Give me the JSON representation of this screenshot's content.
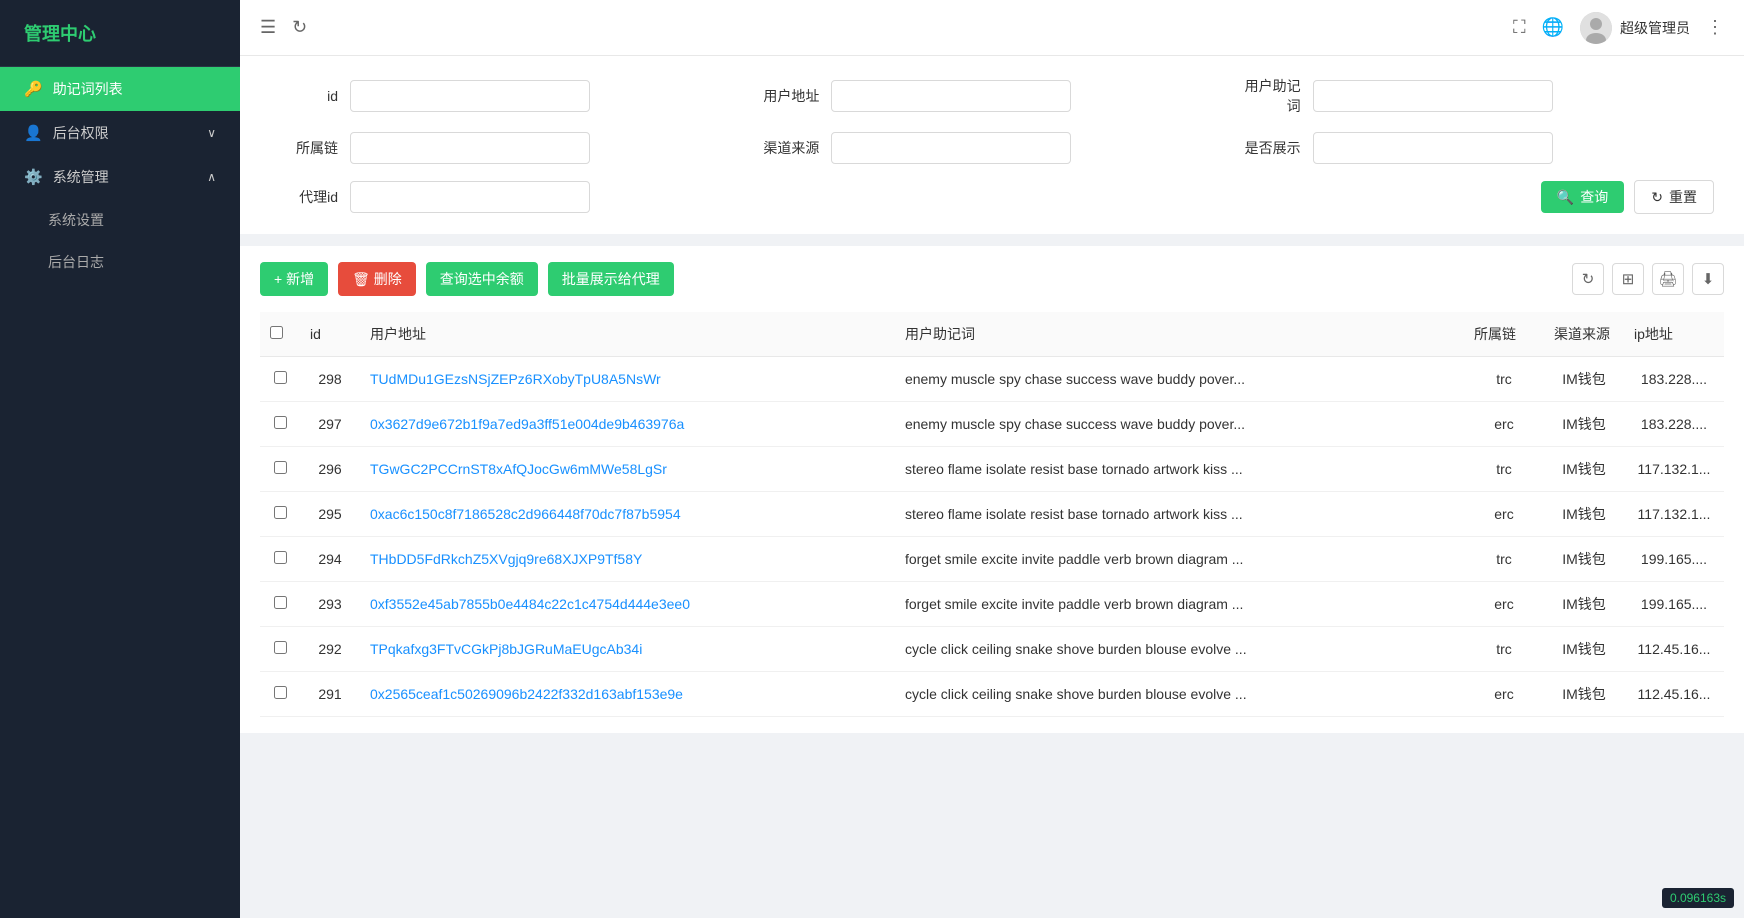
{
  "sidebar": {
    "title": "管理中心",
    "items": [
      {
        "id": "mnemonic",
        "label": "助记词列表",
        "icon": "🔑",
        "active": true,
        "hasChildren": false
      },
      {
        "id": "backend-perms",
        "label": "后台权限",
        "icon": "👤",
        "active": false,
        "hasChildren": true,
        "expanded": false
      },
      {
        "id": "system-mgmt",
        "label": "系统管理",
        "icon": "⚙️",
        "active": false,
        "hasChildren": true,
        "expanded": true
      }
    ],
    "subItems": [
      {
        "id": "system-settings",
        "label": "系统设置",
        "parent": "system-mgmt"
      },
      {
        "id": "backend-log",
        "label": "后台日志",
        "parent": "system-mgmt"
      }
    ]
  },
  "header": {
    "toggleIcon": "☰",
    "refreshIcon": "↻",
    "fullscreenIcon": "⛶",
    "globeIcon": "🌐",
    "moreIcon": "⋮",
    "username": "超级管理员"
  },
  "filter": {
    "fields": [
      {
        "id": "id",
        "label": "id",
        "placeholder": ""
      },
      {
        "id": "user-address",
        "label": "用户地址",
        "placeholder": ""
      },
      {
        "id": "user-mnemonic",
        "label": "用户助记词",
        "placeholder": ""
      },
      {
        "id": "chain",
        "label": "所属链",
        "placeholder": ""
      },
      {
        "id": "channel-source",
        "label": "渠道来源",
        "placeholder": ""
      },
      {
        "id": "is-show",
        "label": "是否展示",
        "placeholder": ""
      },
      {
        "id": "agent-id",
        "label": "代理id",
        "placeholder": ""
      }
    ],
    "searchBtn": "查询",
    "resetBtn": "重置"
  },
  "toolbar": {
    "addBtn": "+ 新增",
    "deleteBtn": "🗑 删除",
    "queryBalanceBtn": "查询选中余额",
    "batchShowBtn": "批量展示给代理"
  },
  "table": {
    "columns": [
      {
        "id": "checkbox",
        "label": ""
      },
      {
        "id": "id",
        "label": "id"
      },
      {
        "id": "user-address",
        "label": "用户地址"
      },
      {
        "id": "user-mnemonic",
        "label": "用户助记词"
      },
      {
        "id": "chain",
        "label": "所属链"
      },
      {
        "id": "channel-source",
        "label": "渠道来源"
      },
      {
        "id": "ip-address",
        "label": "ip地址"
      }
    ],
    "rows": [
      {
        "id": "298",
        "userAddress": "TUdMDu1GEzsNSjZEPz6RXobyTpU8A5NsWr",
        "userMnemonic": "enemy muscle spy chase success wave buddy pover...",
        "chain": "trc",
        "channelSource": "IM钱包",
        "ipAddress": "183.228...."
      },
      {
        "id": "297",
        "userAddress": "0x3627d9e672b1f9a7ed9a3ff51e004de9b463976a",
        "userMnemonic": "enemy muscle spy chase success wave buddy pover...",
        "chain": "erc",
        "channelSource": "IM钱包",
        "ipAddress": "183.228...."
      },
      {
        "id": "296",
        "userAddress": "TGwGC2PCCrnST8xAfQJocGw6mMWe58LgSr",
        "userMnemonic": "stereo flame isolate resist base tornado artwork kiss ...",
        "chain": "trc",
        "channelSource": "IM钱包",
        "ipAddress": "117.132.1..."
      },
      {
        "id": "295",
        "userAddress": "0xac6c150c8f7186528c2d966448f70dc7f87b5954",
        "userMnemonic": "stereo flame isolate resist base tornado artwork kiss ...",
        "chain": "erc",
        "channelSource": "IM钱包",
        "ipAddress": "117.132.1..."
      },
      {
        "id": "294",
        "userAddress": "THbDD5FdRkchZ5XVgjq9re68XJXP9Tf58Y",
        "userMnemonic": "forget smile excite invite paddle verb brown diagram ...",
        "chain": "trc",
        "channelSource": "IM钱包",
        "ipAddress": "199.165...."
      },
      {
        "id": "293",
        "userAddress": "0xf3552e45ab7855b0e4484c22c1c4754d444e3ee0",
        "userMnemonic": "forget smile excite invite paddle verb brown diagram ...",
        "chain": "erc",
        "channelSource": "IM钱包",
        "ipAddress": "199.165...."
      },
      {
        "id": "292",
        "userAddress": "TPqkafxg3FTvCGkPj8bJGRuMaEUgcAb34i",
        "userMnemonic": "cycle click ceiling snake shove burden blouse evolve ...",
        "chain": "trc",
        "channelSource": "IM钱包",
        "ipAddress": "112.45.16..."
      },
      {
        "id": "291",
        "userAddress": "0x2565ceaf1c50269096b2422f332d163abf153e9e",
        "userMnemonic": "cycle click ceiling snake shove burden blouse evolve ...",
        "chain": "erc",
        "channelSource": "IM钱包",
        "ipAddress": "112.45.16..."
      }
    ]
  },
  "version": "0.096163s"
}
